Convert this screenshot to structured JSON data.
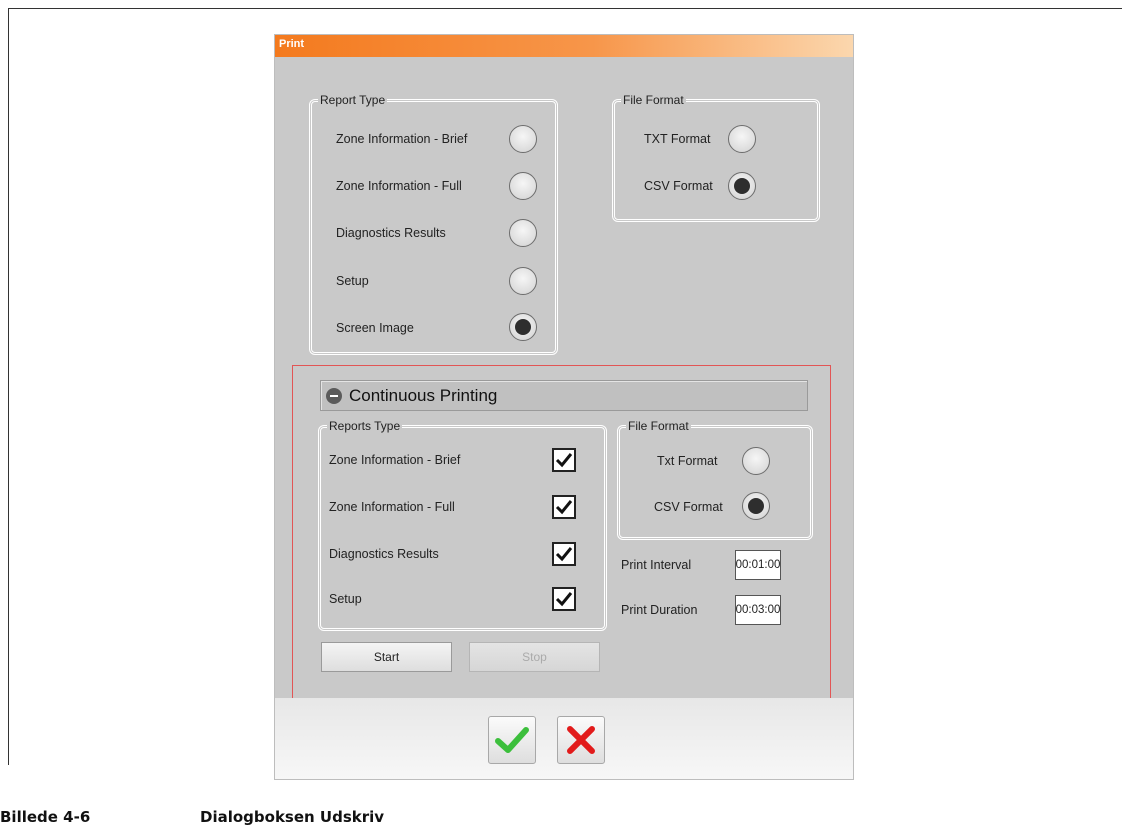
{
  "dialog": {
    "title": "Print",
    "report_type": {
      "legend": "Report Type",
      "options": [
        {
          "label": "Zone Information - Brief",
          "selected": false
        },
        {
          "label": "Zone Information - Full",
          "selected": false
        },
        {
          "label": "Diagnostics Results",
          "selected": false
        },
        {
          "label": "Setup",
          "selected": false
        },
        {
          "label": "Screen Image",
          "selected": true
        }
      ]
    },
    "file_format": {
      "legend": "File Format",
      "options": [
        {
          "label": "TXT Format",
          "selected": false
        },
        {
          "label": "CSV Format",
          "selected": true
        }
      ]
    },
    "continuous": {
      "title": "Continuous Printing",
      "reports_type": {
        "legend": "Reports Type",
        "options": [
          {
            "label": "Zone Information - Brief",
            "checked": true
          },
          {
            "label": "Zone Information - Full",
            "checked": true
          },
          {
            "label": "Diagnostics Results",
            "checked": true
          },
          {
            "label": "Setup",
            "checked": true
          }
        ]
      },
      "file_format": {
        "legend": "File Format",
        "options": [
          {
            "label": "Txt Format",
            "selected": false
          },
          {
            "label": "CSV Format",
            "selected": true
          }
        ]
      },
      "print_interval": {
        "label": "Print Interval",
        "value": "00:01:00"
      },
      "print_duration": {
        "label": "Print Duration",
        "value": "00:03:00"
      },
      "start_label": "Start",
      "stop_label": "Stop"
    },
    "ok_icon": "checkmark-icon",
    "cancel_icon": "x-icon"
  },
  "caption": {
    "number": "Billede 4-6",
    "text": "Dialogboksen Udskriv"
  },
  "colors": {
    "title_bar": "#f47a1e",
    "continuous_border": "#e25555",
    "ok": "#3cbf3c",
    "cancel": "#e21b1b"
  }
}
